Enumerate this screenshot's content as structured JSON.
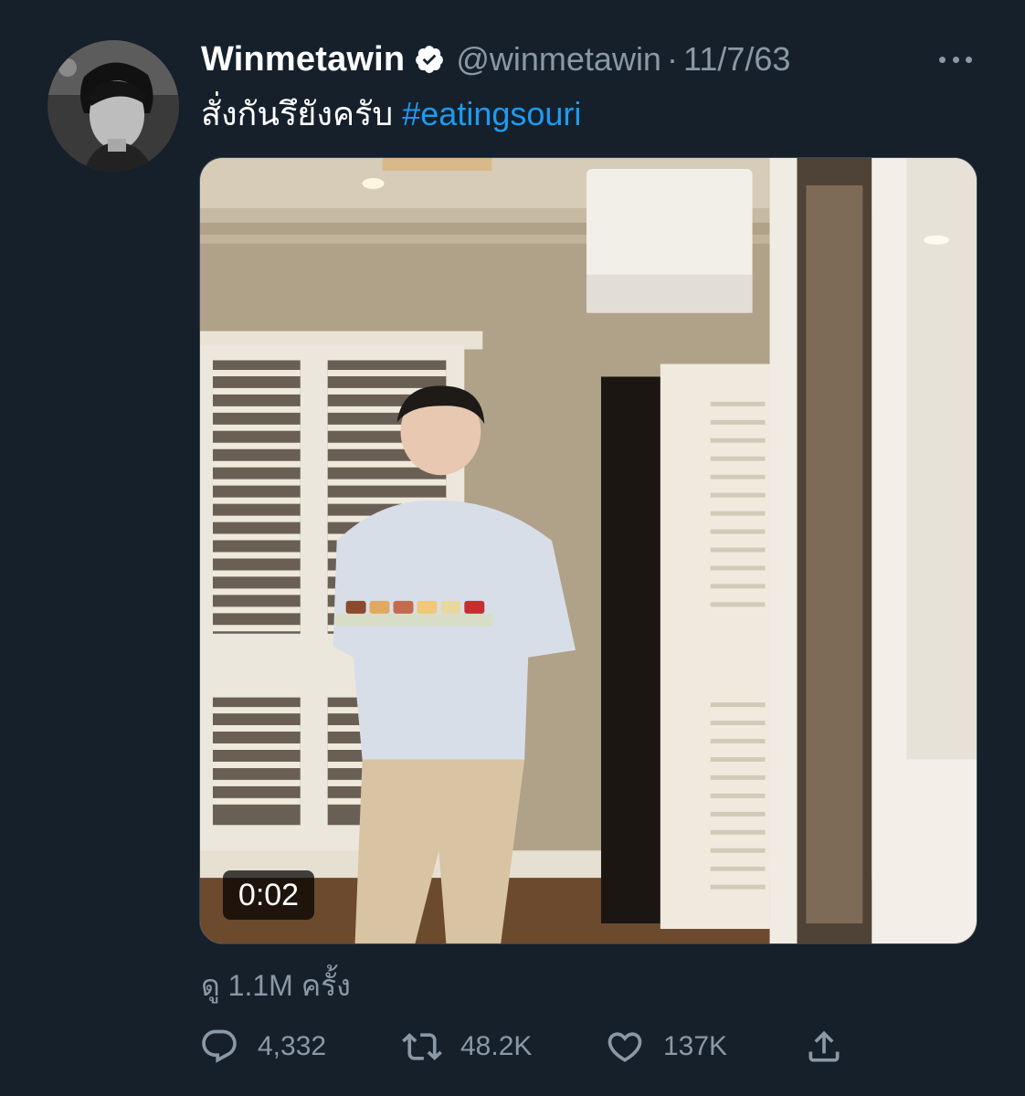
{
  "author": {
    "display_name": "Winmetawin",
    "handle": "@winmetawin",
    "separator": "·",
    "date": "11/7/63",
    "verified": true
  },
  "tweet": {
    "text": "สั่งกันรึยังครับ ",
    "hashtag": "#eatingsouri"
  },
  "media": {
    "type": "video",
    "duration": "0:02"
  },
  "views": {
    "label": "ดู 1.1M ครั้ง"
  },
  "actions": {
    "reply_count": "4,332",
    "retweet_count": "48.2K",
    "like_count": "137K"
  },
  "icons": {
    "more": "more-horizontal-icon",
    "verified": "verified-badge-icon",
    "reply": "reply-icon",
    "retweet": "retweet-icon",
    "like": "heart-icon",
    "share": "share-icon"
  },
  "colors": {
    "background": "#15202b",
    "secondary_text": "#8b98a5",
    "accent": "#1d9bf0"
  }
}
